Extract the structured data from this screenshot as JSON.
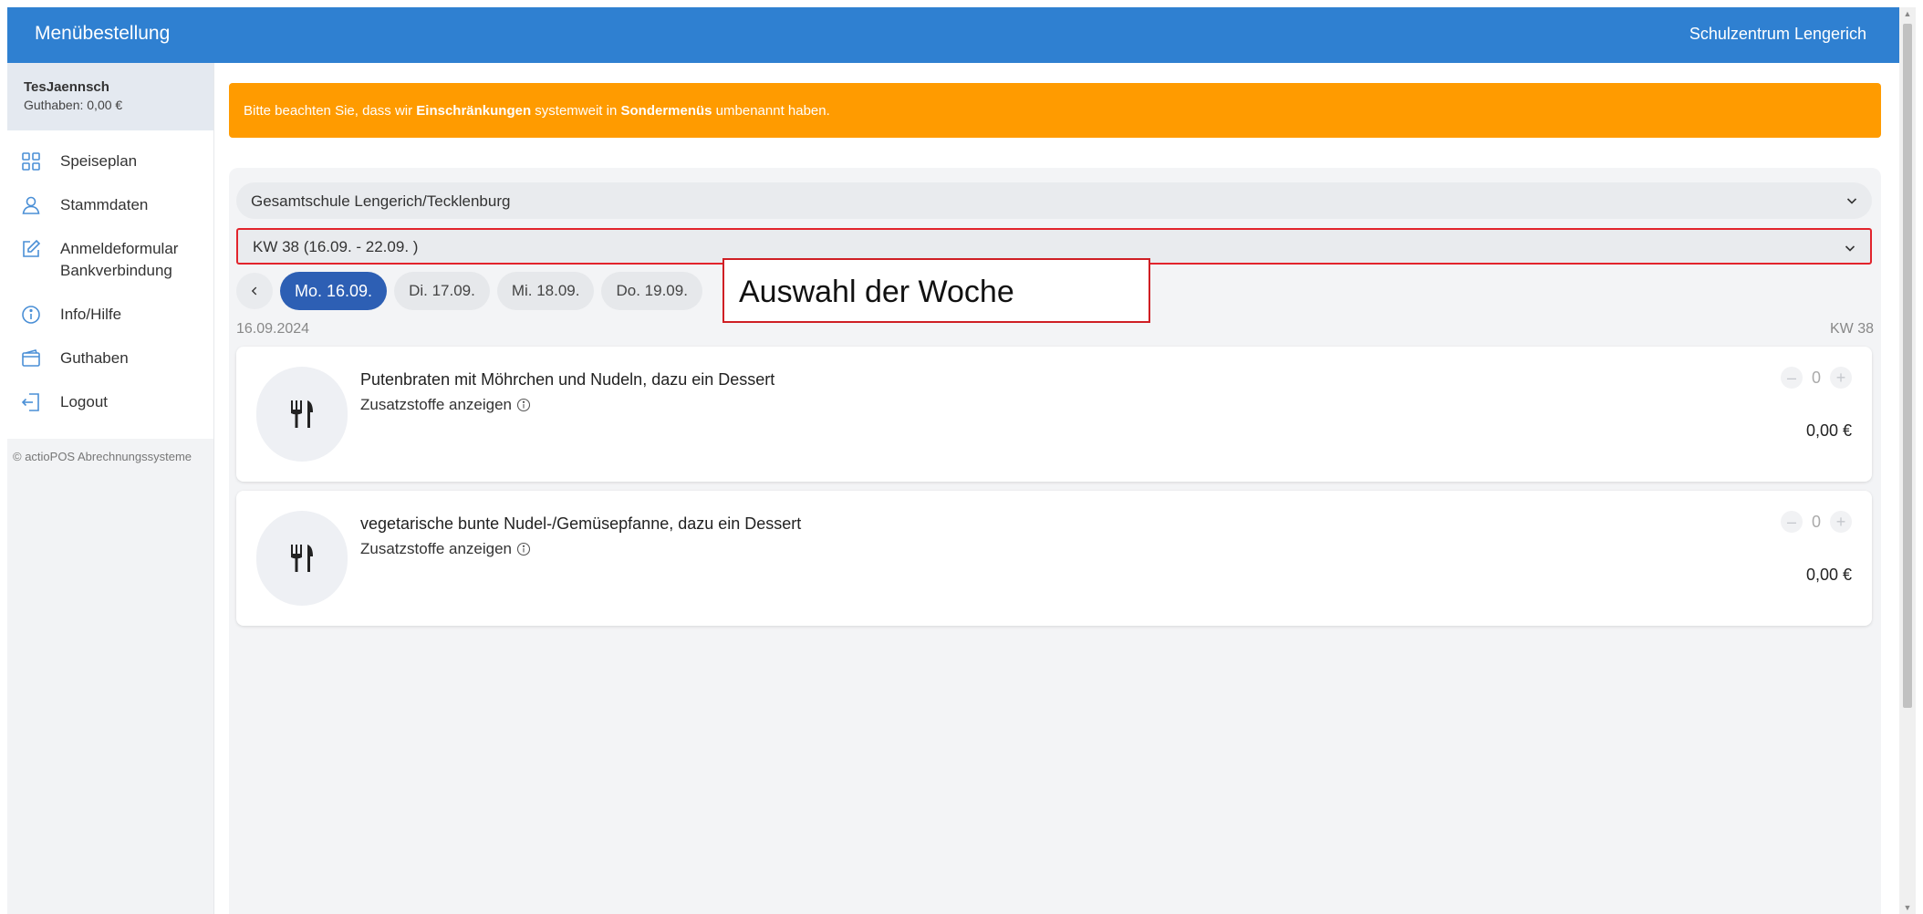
{
  "header": {
    "app_title": "Menübestellung",
    "school": "Schulzentrum Lengerich"
  },
  "user": {
    "name": "TesJaennsch",
    "balance": "Guthaben: 0,00 €"
  },
  "sidebar": {
    "items": [
      {
        "label": "Speiseplan",
        "icon": "grid-icon"
      },
      {
        "label": "Stammdaten",
        "icon": "user-icon"
      },
      {
        "label": "Anmeldeformular",
        "label2": "Bankverbindung",
        "icon": "edit-icon"
      },
      {
        "label": "Info/Hilfe",
        "icon": "info-icon"
      },
      {
        "label": "Guthaben",
        "icon": "wallet-icon"
      },
      {
        "label": "Logout",
        "icon": "logout-icon"
      }
    ],
    "copyright": "© actioPOS Abrechnungssysteme"
  },
  "notice": {
    "pre": "Bitte beachten Sie, dass wir ",
    "bold1": "Einschränkungen",
    "mid": " systemweit in ",
    "bold2": "Sondermenüs",
    "post": " umbenannt haben."
  },
  "selects": {
    "school": "Gesamtschule Lengerich/Tecklenburg",
    "week": "KW 38 (16.09. - 22.09. )"
  },
  "days": [
    {
      "label": "Mo. 16.09.",
      "active": true
    },
    {
      "label": "Di. 17.09.",
      "active": false
    },
    {
      "label": "Mi. 18.09.",
      "active": false
    },
    {
      "label": "Do. 19.09.",
      "active": false
    }
  ],
  "date_line": "16.09.2024",
  "kw_line": "KW 38",
  "annotation": "Auswahl der Woche",
  "menus": [
    {
      "name": "Putenbraten mit Möhrchen und Nudeln, dazu ein Dessert",
      "additives": "Zusatzstoffe anzeigen",
      "qty": "0",
      "price": "0,00 €"
    },
    {
      "name": "vegetarische bunte Nudel-/Gemüsepfanne, dazu ein Dessert",
      "additives": "Zusatzstoffe anzeigen",
      "qty": "0",
      "price": "0,00 €"
    }
  ],
  "colors": {
    "header": "#2f80d1",
    "notice": "#ff9b00",
    "active_day": "#2d5fb4",
    "annotation_border": "#cf1f24"
  }
}
